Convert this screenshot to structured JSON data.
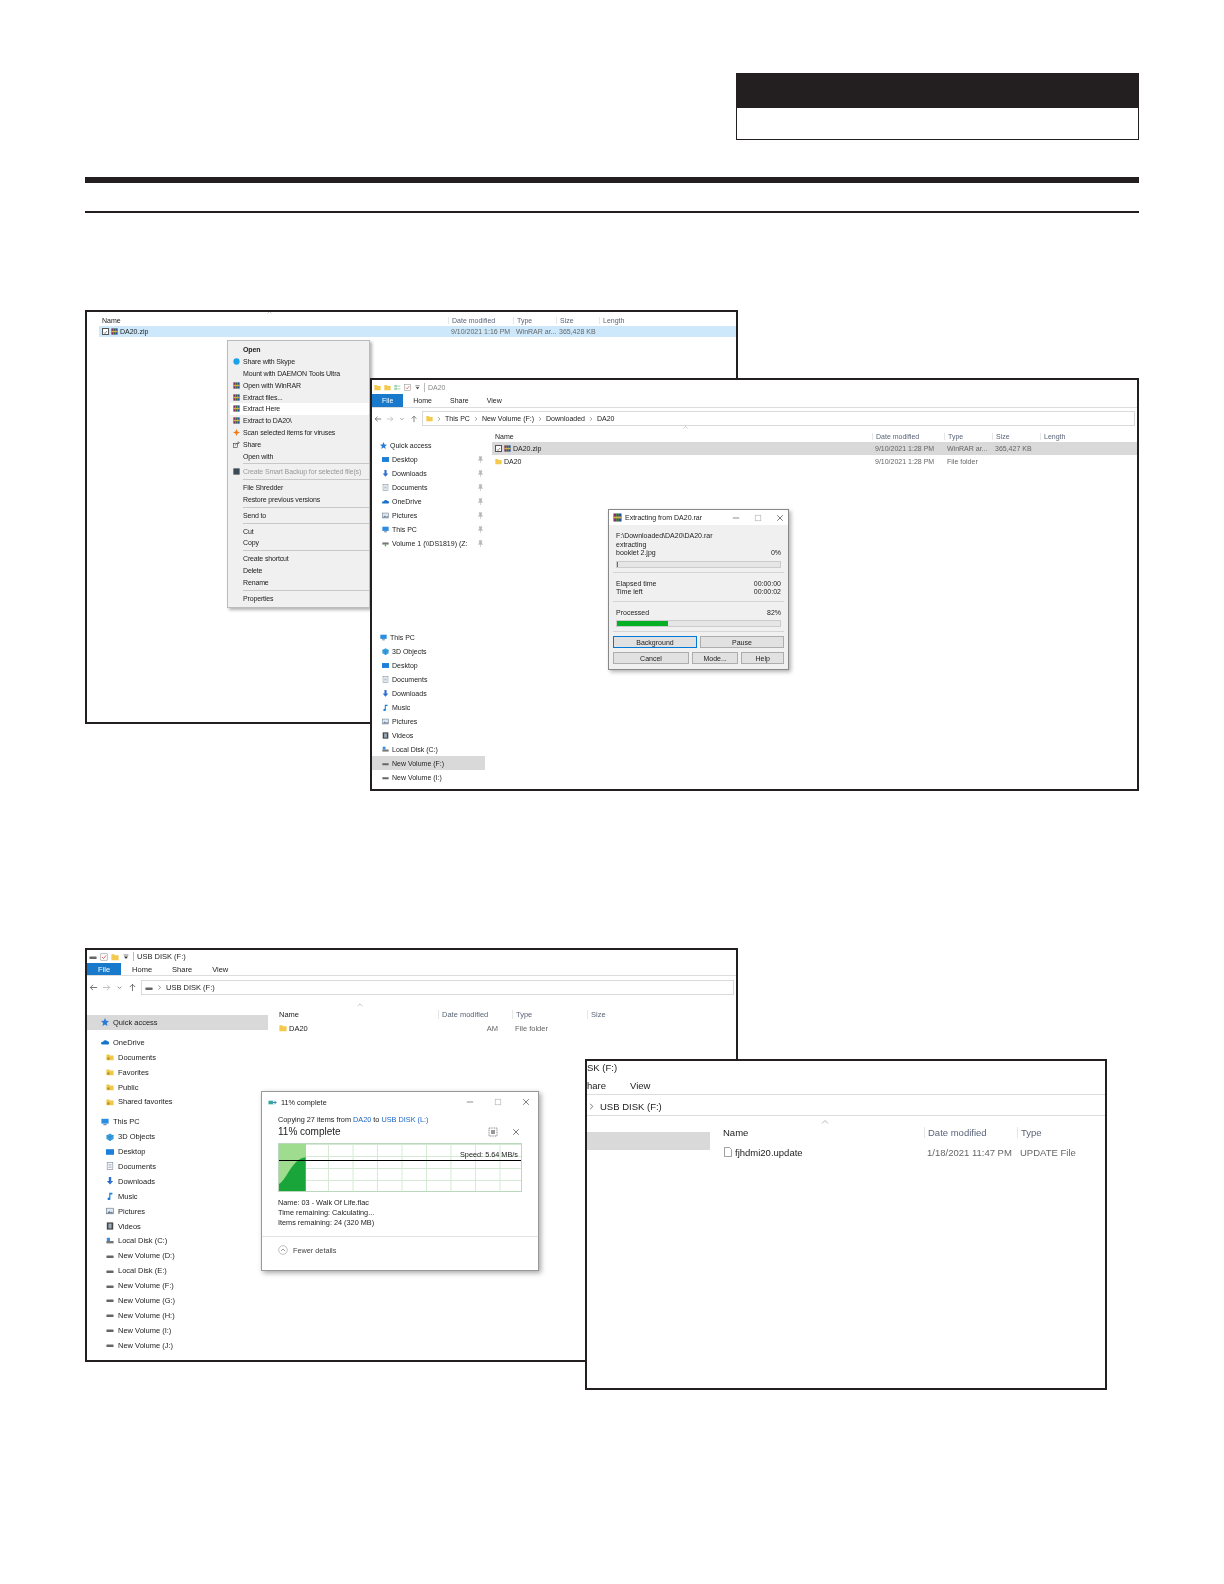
{
  "extract_context_menu_screenshot": {
    "columns": [
      "Name",
      "Date modified",
      "Type",
      "Size",
      "Length"
    ],
    "rows": [
      {
        "kind": "archive",
        "checked": true,
        "selected": true,
        "cells": [
          "DA20.zip",
          "9/10/2021 1:16 PM",
          "WinRAR ar...",
          "365,428 KB"
        ]
      }
    ],
    "context_menu": [
      [
        {
          "label": "Open",
          "kind": "plain",
          "default": true,
          "disabled": false,
          "selected": false
        },
        {
          "label": "Share with Skype",
          "kind": "skype",
          "default": false,
          "disabled": false,
          "selected": false
        },
        {
          "label": "Mount with DAEMON Tools Ultra",
          "kind": "plain",
          "default": false,
          "disabled": false,
          "selected": false
        },
        {
          "label": "Open with WinRAR",
          "kind": "archive",
          "default": false,
          "disabled": false,
          "selected": false
        },
        {
          "label": "Extract files...",
          "kind": "archive",
          "default": false,
          "disabled": false,
          "selected": false
        },
        {
          "label": "Extract Here",
          "kind": "archive",
          "default": false,
          "disabled": false,
          "selected": true
        },
        {
          "label": "Extract to DA20\\",
          "kind": "archive",
          "default": false,
          "disabled": false,
          "selected": false
        },
        {
          "label": "Scan selected items for viruses",
          "kind": "scan",
          "default": false,
          "disabled": false,
          "selected": false
        },
        {
          "label": "Share",
          "kind": "share",
          "default": false,
          "disabled": false,
          "selected": false
        },
        {
          "label": "Open with",
          "kind": "plain",
          "default": false,
          "disabled": false,
          "selected": false
        }
      ],
      [
        {
          "label": "Create Smart Backup for selected file(s)",
          "kind": "backup",
          "default": false,
          "disabled": true,
          "selected": false
        }
      ],
      [
        {
          "label": "File Shredder",
          "kind": "plain",
          "default": false,
          "disabled": false,
          "selected": false
        },
        {
          "label": "Restore previous versions",
          "kind": "plain",
          "default": false,
          "disabled": false,
          "selected": false
        }
      ],
      [
        {
          "label": "Send to",
          "kind": "plain",
          "default": false,
          "disabled": false,
          "selected": false
        }
      ],
      [
        {
          "label": "Cut",
          "kind": "plain",
          "default": false,
          "disabled": false,
          "selected": false
        },
        {
          "label": "Copy",
          "kind": "plain",
          "default": false,
          "disabled": false,
          "selected": false
        }
      ],
      [
        {
          "label": "Create shortcut",
          "kind": "plain",
          "default": false,
          "disabled": false,
          "selected": false
        },
        {
          "label": "Delete",
          "kind": "plain",
          "default": false,
          "disabled": false,
          "selected": false
        },
        {
          "label": "Rename",
          "kind": "plain",
          "default": false,
          "disabled": false,
          "selected": false
        }
      ],
      [
        {
          "label": "Properties",
          "kind": "plain",
          "default": false,
          "disabled": false,
          "selected": false
        }
      ]
    ]
  },
  "explorer_downloaded": {
    "title": "DA20",
    "tabs": [
      {
        "label": "File",
        "selected": true
      },
      {
        "label": "Home",
        "selected": false
      },
      {
        "label": "Share",
        "selected": false
      },
      {
        "label": "View",
        "selected": false
      }
    ],
    "address": {
      "nav_buttons": true,
      "crumbs": [
        "This PC",
        "New Volume (F:)",
        "Downloaded",
        "DA20"
      ]
    },
    "nav": [
      {
        "label": "Quick access",
        "kind": "star",
        "selected": false,
        "pinned": false,
        "children": [
          {
            "label": "Desktop",
            "kind": "desktop",
            "selected": false,
            "pinned": true
          },
          {
            "label": "Downloads",
            "kind": "downloads",
            "selected": false,
            "pinned": true
          },
          {
            "label": "Documents",
            "kind": "documents",
            "selected": false,
            "pinned": true
          },
          {
            "label": "OneDrive",
            "kind": "cloud",
            "selected": false,
            "pinned": true
          },
          {
            "label": "Pictures",
            "kind": "pictures",
            "selected": false,
            "pinned": true
          },
          {
            "label": "This PC",
            "kind": "pc",
            "selected": false,
            "pinned": true
          },
          {
            "label": "Volume 1 (\\\\DS1819) (Z:",
            "kind": "netdrive",
            "selected": false,
            "pinned": true
          }
        ]
      },
      {
        "label": "This PC",
        "kind": "pc",
        "selected": false,
        "pinned": false,
        "children": [
          {
            "label": "3D Objects",
            "kind": "objects",
            "selected": false,
            "pinned": false
          },
          {
            "label": "Desktop",
            "kind": "desktop",
            "selected": false,
            "pinned": false
          },
          {
            "label": "Documents",
            "kind": "documents",
            "selected": false,
            "pinned": false
          },
          {
            "label": "Downloads",
            "kind": "downloads",
            "selected": false,
            "pinned": false
          },
          {
            "label": "Music",
            "kind": "music",
            "selected": false,
            "pinned": false
          },
          {
            "label": "Pictures",
            "kind": "pictures",
            "selected": false,
            "pinned": false
          },
          {
            "label": "Videos",
            "kind": "videos",
            "selected": false,
            "pinned": false
          },
          {
            "label": "Local Disk (C:)",
            "kind": "localdisk",
            "selected": false,
            "pinned": false
          },
          {
            "label": "New Volume (F:)",
            "kind": "drive",
            "selected": true,
            "pinned": false
          },
          {
            "label": "New Volume (I:)",
            "kind": "drive",
            "selected": false,
            "pinned": false
          }
        ]
      }
    ],
    "columns": [
      "Name",
      "Date modified",
      "Type",
      "Size",
      "Length"
    ],
    "rows": [
      {
        "kind": "archive",
        "checked": true,
        "selected": true,
        "cells": [
          "DA20.zip",
          "9/10/2021 1:28 PM",
          "WinRAR ar...",
          "365,427 KB"
        ]
      },
      {
        "kind": "folder",
        "checked": false,
        "selected": false,
        "cells": [
          "DA20",
          "9/10/2021 1:28 PM",
          "File folder"
        ]
      }
    ],
    "dialog": {
      "title": "Extracting from DA20.rar",
      "archive_path": "F:\\Downloaded\\DA20\\DA20.rar",
      "action": "extracting",
      "current_file": "booklet 2.jpg",
      "file_progress": {
        "reading": "0%",
        "level": 0
      },
      "times": [
        {
          "label": "Elapsed time",
          "value": "00:00:00"
        },
        {
          "label": "Time left",
          "value": "00:00:02"
        }
      ],
      "total_progress": {
        "label": "Processed",
        "reading": "82%",
        "level": 0.31
      },
      "buttons": [
        [
          {
            "label": "Background",
            "focused": true
          },
          {
            "label": "Pause",
            "focused": false
          }
        ],
        [
          {
            "label": "Cancel",
            "focused": false
          },
          {
            "label": "Mode...",
            "focused": false
          },
          {
            "label": "Help",
            "focused": false
          }
        ]
      ]
    }
  },
  "explorer_usb": {
    "title": "USB DISK (F:)",
    "tabs": [
      {
        "label": "File",
        "selected": true
      },
      {
        "label": "Home",
        "selected": false
      },
      {
        "label": "Share",
        "selected": false
      },
      {
        "label": "View",
        "selected": false
      }
    ],
    "address": {
      "nav_buttons": true,
      "crumbs": [
        "USB DISK (F:)"
      ]
    },
    "nav": [
      {
        "label": "Quick access",
        "kind": "star",
        "selected": true
      },
      {
        "label": "OneDrive",
        "kind": "cloud",
        "selected": false,
        "children": [
          {
            "label": "Documents",
            "kind": "userfolder",
            "selected": false
          },
          {
            "label": "Favorites",
            "kind": "userfolder",
            "selected": false
          },
          {
            "label": "Public",
            "kind": "userfolder",
            "selected": false
          },
          {
            "label": "Shared favorites",
            "kind": "userfolder",
            "selected": false
          }
        ]
      },
      {
        "label": "This PC",
        "kind": "pc",
        "selected": false,
        "children": [
          {
            "label": "3D Objects",
            "kind": "objects",
            "selected": false
          },
          {
            "label": "Desktop",
            "kind": "desktop",
            "selected": false
          },
          {
            "label": "Documents",
            "kind": "documents",
            "selected": false
          },
          {
            "label": "Downloads",
            "kind": "downloads",
            "selected": false
          },
          {
            "label": "Music",
            "kind": "music",
            "selected": false
          },
          {
            "label": "Pictures",
            "kind": "pictures",
            "selected": false
          },
          {
            "label": "Videos",
            "kind": "videos",
            "selected": false
          },
          {
            "label": "Local Disk (C:)",
            "kind": "localdisk",
            "selected": false
          },
          {
            "label": "New Volume (D:)",
            "kind": "drive",
            "selected": false
          },
          {
            "label": "Local Disk (E:)",
            "kind": "drive",
            "selected": false
          },
          {
            "label": "New Volume (F:)",
            "kind": "drive",
            "selected": false
          },
          {
            "label": "New Volume (G:)",
            "kind": "drive",
            "selected": false
          },
          {
            "label": "New Volume (H:)",
            "kind": "drive",
            "selected": false
          },
          {
            "label": "New Volume (I:)",
            "kind": "drive",
            "selected": false
          },
          {
            "label": "New Volume (J:)",
            "kind": "drive",
            "selected": false
          }
        ]
      }
    ],
    "columns": [
      "Name",
      "Date modified",
      "Type",
      "Size"
    ],
    "rows": [
      {
        "kind": "folder",
        "checked": false,
        "selected": false,
        "cells": [
          "DA20",
          "AM",
          "File folder"
        ]
      }
    ],
    "dialog": {
      "title": "11% complete",
      "summary": [
        {
          "text": "Copying 27 items from ",
          "link": false
        },
        {
          "text": "DA20",
          "link": true
        },
        {
          "text": " to ",
          "link": false
        },
        {
          "text": "USB DISK (L:)",
          "link": true
        }
      ],
      "headline": "11% complete",
      "speed": "Speed: 5.64 MB/s",
      "progress": {
        "level": 0.11
      },
      "details": [
        "Name: 03 - Walk Of Life.flac",
        "Time remaining: Calculating...",
        "Items remaining: 24 (320 MB)"
      ],
      "toggle": "Fewer details"
    }
  },
  "explorer_usb_detail": {
    "title": "SK (F:)",
    "tabs": [
      {
        "label": "hare",
        "selected": false
      },
      {
        "label": "View",
        "selected": false
      }
    ],
    "address": {
      "nav_buttons": false,
      "crumbs": [
        "USB DISK (F:)"
      ]
    },
    "nav": [
      {
        "selected": true
      }
    ],
    "columns": [
      "Name",
      "Date modified",
      "Type"
    ],
    "rows": [
      {
        "kind": "file",
        "checked": false,
        "selected": false,
        "cells": [
          "fjhdmi20.update",
          "1/18/2021 11:47 PM",
          "UPDATE File"
        ]
      }
    ]
  }
}
